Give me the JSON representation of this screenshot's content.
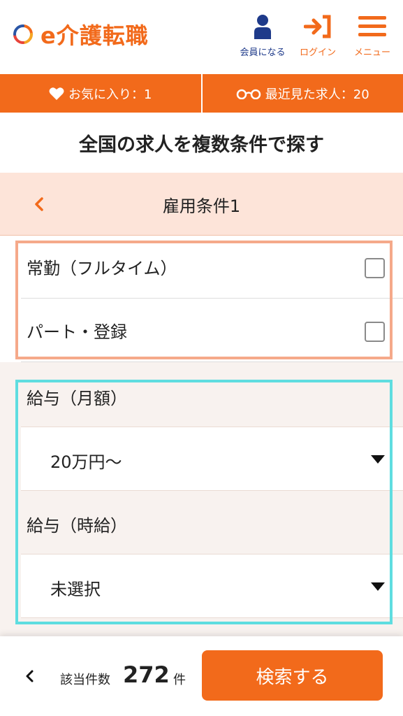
{
  "header": {
    "logo_text": "e介護転職",
    "member_label": "会員になる",
    "login_label": "ログイン",
    "menu_label": "メニュー"
  },
  "nav_bar": {
    "favorites_label": "お気に入り：1",
    "recent_label": "最近見た求人：20"
  },
  "page_title": "全国の求人を複数条件で探す",
  "section": {
    "title": "雇用条件1"
  },
  "employment_options": [
    {
      "label": "常勤（フルタイム）",
      "checked": false
    },
    {
      "label": "パート・登録",
      "checked": false
    }
  ],
  "salary": {
    "monthly_label": "給与（月額）",
    "monthly_value": "20万円〜",
    "hourly_label": "給与（時給）",
    "hourly_value": "未選択"
  },
  "footer": {
    "result_label": "該当件数",
    "result_count": "272",
    "result_unit": "件",
    "search_button": "検索する"
  },
  "colors": {
    "brand_orange": "#f26a1b",
    "section_header_bg": "#fde4d9",
    "highlight_orange": "#f5a98a",
    "highlight_cyan": "#5fdde0",
    "member_icon": "#1e3a8a"
  },
  "icons": {
    "logo": "logo-ring-icon",
    "member": "person-icon",
    "login": "login-arrow-icon",
    "menu": "hamburger-icon",
    "favorites": "heart-icon",
    "recent": "glasses-icon",
    "back": "chevron-left-icon",
    "select": "caret-down-icon"
  }
}
